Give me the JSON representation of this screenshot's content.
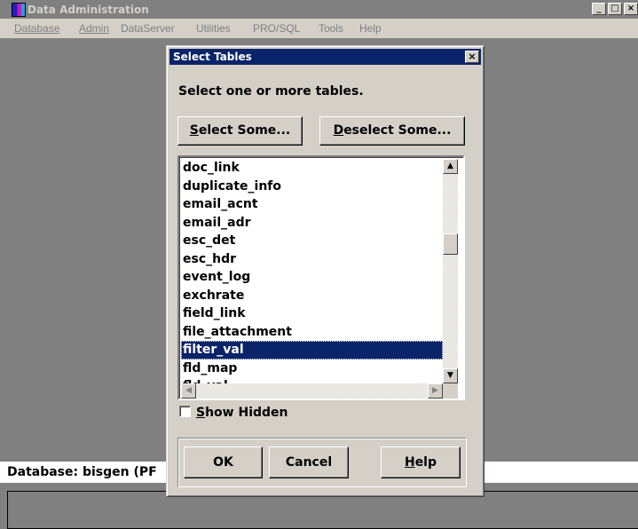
{
  "window": {
    "title": "Data Administration",
    "buttons": [
      "_",
      "□",
      "×"
    ]
  },
  "menubar": {
    "items": [
      "Database",
      "Admin",
      "DataServer",
      "Utilities",
      "PRO/SQL",
      "Tools",
      "Help"
    ],
    "underline_first": true
  },
  "status": {
    "text": "Database: bisgen (PF"
  },
  "dialog": {
    "title": "Select Tables",
    "close_label": "×",
    "prompt": "Select one or more tables.",
    "select_some_key": "S",
    "select_some_rest": "elect Some...",
    "deselect_some_key": "D",
    "deselect_some_rest": "eselect Some...",
    "tables": [
      "doc_link",
      "duplicate_info",
      "email_acnt",
      "email_adr",
      "esc_det",
      "esc_hdr",
      "event_log",
      "exchrate",
      "field_link",
      "file_attachment",
      "filter_val",
      "fld_map",
      "fld_val..."
    ],
    "selected_table": "filter_val",
    "show_hidden_key": "S",
    "show_hidden_rest": "how Hidden",
    "show_hidden_checked": false,
    "ok_label": "OK",
    "cancel_label": "Cancel",
    "help_key": "H",
    "help_rest": "elp"
  },
  "icons": {
    "scroll_up": "scroll-up-icon",
    "scroll_down": "scroll-down-icon",
    "scroll_left": "scroll-left-icon",
    "scroll_right": "scroll-right-icon",
    "app": "app-icon"
  },
  "colors": {
    "selection": "#0a246a",
    "face": "#d4d0c8",
    "desktop": "#808080"
  }
}
